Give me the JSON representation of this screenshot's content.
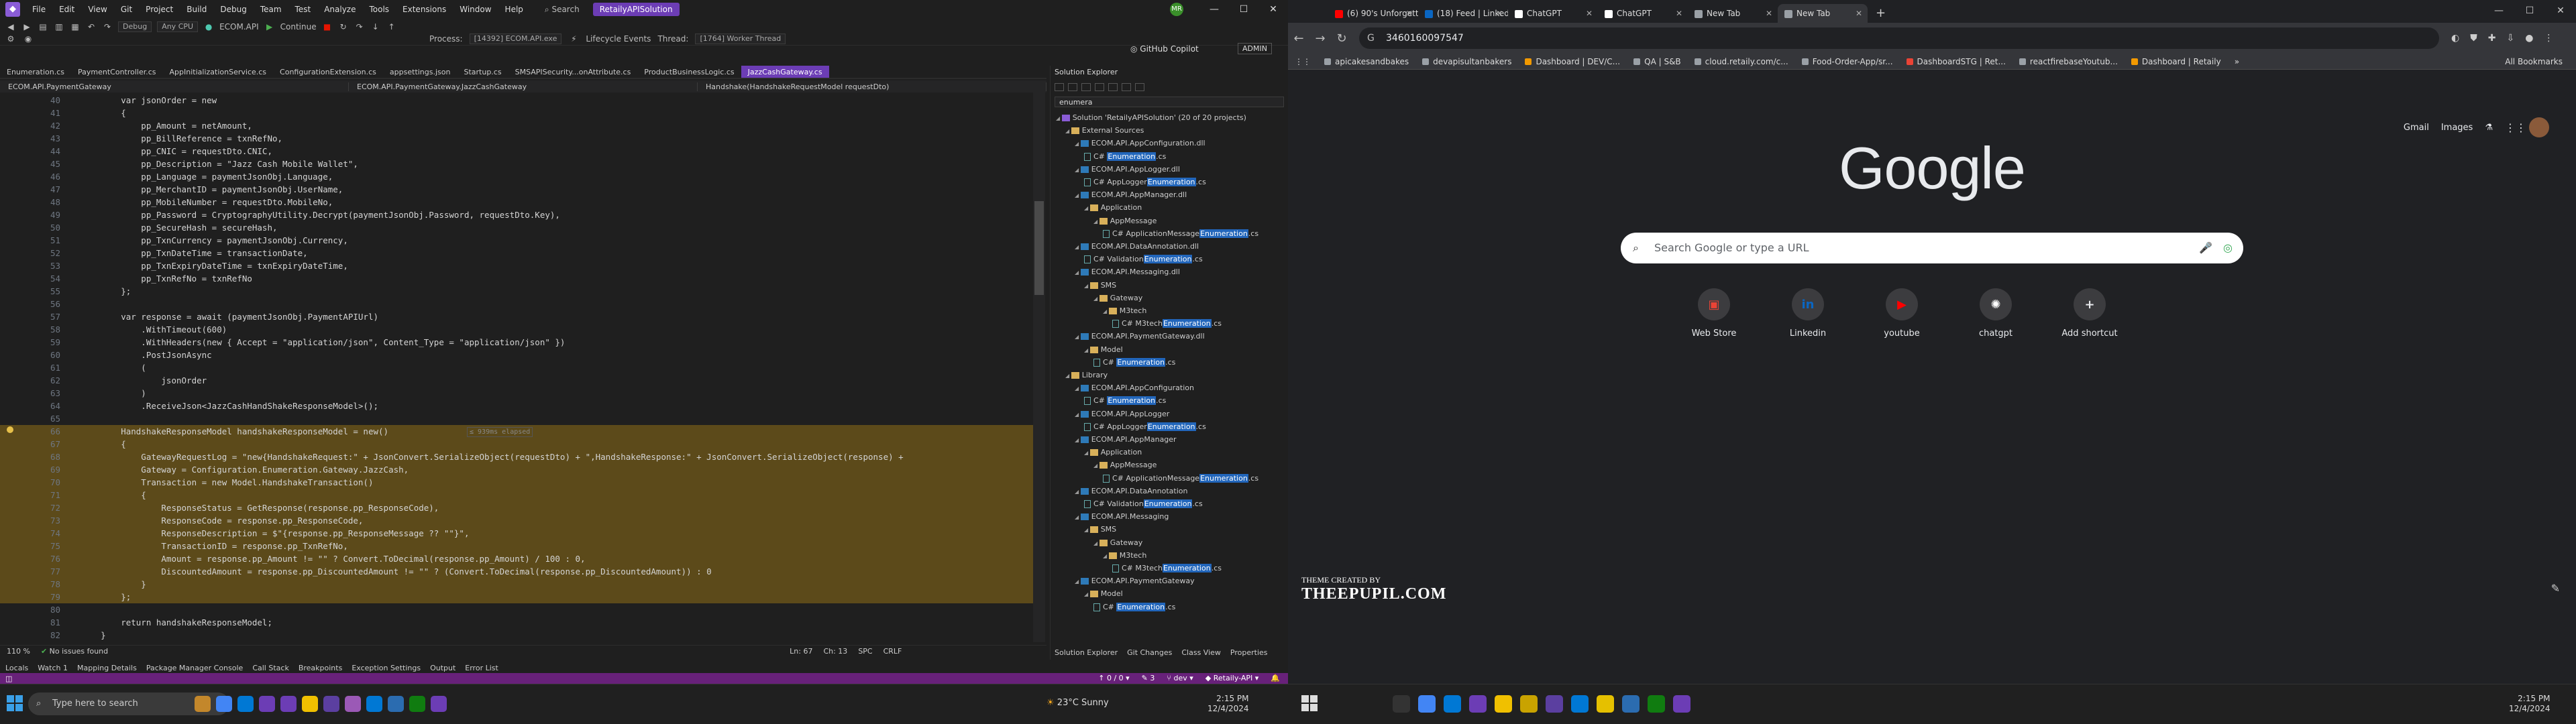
{
  "vs": {
    "menu": [
      "File",
      "Edit",
      "View",
      "Git",
      "Project",
      "Build",
      "Debug",
      "Team",
      "Test",
      "Analyze",
      "Tools",
      "Extensions",
      "Window",
      "Help"
    ],
    "search": "Search",
    "solution_name": "RetailyAPISolution",
    "avatar_initials": "MR",
    "toolbar": {
      "config": "Debug",
      "platform": "Any CPU",
      "startup": "ECOM.API",
      "continue": "Continue",
      "process_label": "Process:",
      "process": "[14392] ECOM.API.exe",
      "lifecycle": "Lifecycle Events",
      "thread_label": "Thread:",
      "thread": "[1764] Worker Thread",
      "copilot": "GitHub Copilot",
      "admin": "ADMIN"
    },
    "tabs": [
      "Enumeration.cs",
      "PaymentController.cs",
      "AppInitializationService.cs",
      "ConfigurationExtension.cs",
      "appsettings.json",
      "Startup.cs",
      "SMSAPISecurity...onAttribute.cs",
      "ProductBusinessLogic.cs",
      "JazzCashGateway.cs"
    ],
    "active_tab": "JazzCashGateway.cs",
    "nav": [
      "ECOM.API.PaymentGateway",
      "ECOM.API.PaymentGateway.JazzCashGateway",
      "Handshake(HandshakeRequestModel requestDto)"
    ],
    "code_lines": [
      {
        "n": "40",
        "t": "        var jsonOrder = new"
      },
      {
        "n": "41",
        "t": "        {"
      },
      {
        "n": "42",
        "t": "            pp_Amount = netAmount,"
      },
      {
        "n": "43",
        "t": "            pp_BillReference = txnRefNo,"
      },
      {
        "n": "44",
        "t": "            pp_CNIC = requestDto.CNIC,"
      },
      {
        "n": "45",
        "t": "            pp_Description = \"Jazz Cash Mobile Wallet\","
      },
      {
        "n": "46",
        "t": "            pp_Language = paymentJsonObj.Language,"
      },
      {
        "n": "47",
        "t": "            pp_MerchantID = paymentJsonObj.UserName,"
      },
      {
        "n": "48",
        "t": "            pp_MobileNumber = requestDto.MobileNo,"
      },
      {
        "n": "49",
        "t": "            pp_Password = CryptographyUtility.Decrypt(paymentJsonObj.Password, requestDto.Key),"
      },
      {
        "n": "50",
        "t": "            pp_SecureHash = secureHash,"
      },
      {
        "n": "51",
        "t": "            pp_TxnCurrency = paymentJsonObj.Currency,"
      },
      {
        "n": "52",
        "t": "            pp_TxnDateTime = transactionDate,"
      },
      {
        "n": "53",
        "t": "            pp_TxnExpiryDateTime = txnExpiryDateTime,"
      },
      {
        "n": "54",
        "t": "            pp_TxnRefNo = txnRefNo"
      },
      {
        "n": "55",
        "t": "        };"
      },
      {
        "n": "56",
        "t": ""
      },
      {
        "n": "57",
        "t": "        var response = await (paymentJsonObj.PaymentAPIUrl)"
      },
      {
        "n": "58",
        "t": "            .WithTimeout(600)"
      },
      {
        "n": "59",
        "t": "            .WithHeaders(new { Accept = \"application/json\", Content_Type = \"application/json\" })"
      },
      {
        "n": "60",
        "t": "            .PostJsonAsync"
      },
      {
        "n": "61",
        "t": "            ("
      },
      {
        "n": "62",
        "t": "                jsonOrder"
      },
      {
        "n": "63",
        "t": "            )"
      },
      {
        "n": "64",
        "t": "            .ReceiveJson<JazzCashHandShakeResponseModel>();"
      },
      {
        "n": "65",
        "t": ""
      },
      {
        "n": "66",
        "t": "        HandshakeResponseModel handshakeResponseModel = new()",
        "hl": true
      },
      {
        "n": "67",
        "t": "        {",
        "hl": true
      },
      {
        "n": "68",
        "t": "            GatewayRequestLog = \"new{HandshakeRequest:\" + JsonConvert.SerializeObject(requestDto) + \",HandshakeResponse:\" + JsonConvert.SerializeObject(response) +",
        "hl": true
      },
      {
        "n": "69",
        "t": "            Gateway = Configuration.Enumeration.Gateway.JazzCash,",
        "hl": true
      },
      {
        "n": "70",
        "t": "            Transaction = new Model.HandshakeTransaction()",
        "hl": true
      },
      {
        "n": "71",
        "t": "            {",
        "hl": true
      },
      {
        "n": "72",
        "t": "                ResponseStatus = GetResponse(response.pp_ResponseCode),",
        "hl": true
      },
      {
        "n": "73",
        "t": "                ResponseCode = response.pp_ResponseCode,",
        "hl": true
      },
      {
        "n": "74",
        "t": "                ResponseDescription = $\"{response.pp_ResponseMessage ?? \"\"}\",",
        "hl": true
      },
      {
        "n": "75",
        "t": "                TransactionID = response.pp_TxnRefNo,",
        "hl": true
      },
      {
        "n": "76",
        "t": "                Amount = response.pp_Amount != \"\" ? Convert.ToDecimal(response.pp_Amount) / 100 : 0,",
        "hl": true
      },
      {
        "n": "77",
        "t": "                DiscountedAmount = response.pp_DiscountedAmount != \"\" ? (Convert.ToDecimal(response.pp_DiscountedAmount)) : 0",
        "hl": true
      },
      {
        "n": "78",
        "t": "            }",
        "hl": true
      },
      {
        "n": "79",
        "t": "        };",
        "hl": true
      },
      {
        "n": "80",
        "t": ""
      },
      {
        "n": "81",
        "t": "        return handshakeResponseModel;"
      },
      {
        "n": "82",
        "t": "    }"
      }
    ],
    "elapsed": "≤ 939ms elapsed",
    "editor_status": {
      "zoom": "110 %",
      "issues": "No issues found",
      "ln": "Ln: 67",
      "ch": "Ch: 13",
      "spc": "SPC",
      "crlf": "CRLF"
    },
    "bottom_tabs": [
      "Locals",
      "Watch 1",
      "Mapping Details",
      "Package Manager Console",
      "Call Stack",
      "Breakpoints",
      "Exception Settings",
      "Output",
      "Error List"
    ],
    "statusbar": {
      "arrows": "↑ 0 / 0 ▾",
      "pencil": "✎ 3",
      "branch": "dev ▾",
      "repo": "Retaily-API ▾"
    },
    "solution_explorer": {
      "title": "Solution Explorer",
      "search": "enumera",
      "tabs": [
        "Solution Explorer",
        "Git Changes",
        "Class View",
        "Properties"
      ],
      "rows": [
        {
          "d": 0,
          "pre": "Solution 'RetailyAPISolution' (20 of 20 projects)",
          "hi": "",
          "post": "",
          "k": "sol"
        },
        {
          "d": 1,
          "pre": "External Sources",
          "hi": "",
          "post": "",
          "k": "folder"
        },
        {
          "d": 2,
          "pre": "ECOM.API.AppConfiguration.dll",
          "hi": "",
          "post": "",
          "k": "file"
        },
        {
          "d": 3,
          "pre": "C# ",
          "hi": "Enumeration",
          "post": ".cs",
          "k": "cs"
        },
        {
          "d": 2,
          "pre": "ECOM.API.AppLogger.dll",
          "hi": "",
          "post": "",
          "k": "file"
        },
        {
          "d": 3,
          "pre": "C# AppLogger",
          "hi": "Enumeration",
          "post": ".cs",
          "k": "cs"
        },
        {
          "d": 2,
          "pre": "ECOM.API.AppManager.dll",
          "hi": "",
          "post": "",
          "k": "file"
        },
        {
          "d": 3,
          "pre": "Application",
          "hi": "",
          "post": "",
          "k": "folder"
        },
        {
          "d": 4,
          "pre": "AppMessage",
          "hi": "",
          "post": "",
          "k": "folder"
        },
        {
          "d": 5,
          "pre": "C# ApplicationMessage",
          "hi": "Enumeration",
          "post": ".cs",
          "k": "cs"
        },
        {
          "d": 2,
          "pre": "ECOM.API.DataAnnotation.dll",
          "hi": "",
          "post": "",
          "k": "file"
        },
        {
          "d": 3,
          "pre": "C# Validation",
          "hi": "Enumeration",
          "post": ".cs",
          "k": "cs"
        },
        {
          "d": 2,
          "pre": "ECOM.API.Messaging.dll",
          "hi": "",
          "post": "",
          "k": "file"
        },
        {
          "d": 3,
          "pre": "SMS",
          "hi": "",
          "post": "",
          "k": "folder"
        },
        {
          "d": 4,
          "pre": "Gateway",
          "hi": "",
          "post": "",
          "k": "folder"
        },
        {
          "d": 5,
          "pre": "M3tech",
          "hi": "",
          "post": "",
          "k": "folder"
        },
        {
          "d": 6,
          "pre": "C# M3tech",
          "hi": "Enumeration",
          "post": ".cs",
          "k": "cs"
        },
        {
          "d": 2,
          "pre": "ECOM.API.PaymentGateway.dll",
          "hi": "",
          "post": "",
          "k": "file"
        },
        {
          "d": 3,
          "pre": "Model",
          "hi": "",
          "post": "",
          "k": "folder"
        },
        {
          "d": 4,
          "pre": "C# ",
          "hi": "Enumeration",
          "post": ".cs",
          "k": "cs"
        },
        {
          "d": 1,
          "pre": "Library",
          "hi": "",
          "post": "",
          "k": "folder"
        },
        {
          "d": 2,
          "pre": "ECOM.API.AppConfiguration",
          "hi": "",
          "post": "",
          "k": "file"
        },
        {
          "d": 3,
          "pre": "C# ",
          "hi": "Enumeration",
          "post": ".cs",
          "k": "cs"
        },
        {
          "d": 2,
          "pre": "ECOM.API.AppLogger",
          "hi": "",
          "post": "",
          "k": "file"
        },
        {
          "d": 3,
          "pre": "C# AppLogger",
          "hi": "Enumeration",
          "post": ".cs",
          "k": "cs"
        },
        {
          "d": 2,
          "pre": "ECOM.API.AppManager",
          "hi": "",
          "post": "",
          "k": "file"
        },
        {
          "d": 3,
          "pre": "Application",
          "hi": "",
          "post": "",
          "k": "folder"
        },
        {
          "d": 4,
          "pre": "AppMessage",
          "hi": "",
          "post": "",
          "k": "folder"
        },
        {
          "d": 5,
          "pre": "C# ApplicationMessage",
          "hi": "Enumeration",
          "post": ".cs",
          "k": "cs"
        },
        {
          "d": 2,
          "pre": "ECOM.API.DataAnnotation",
          "hi": "",
          "post": "",
          "k": "file"
        },
        {
          "d": 3,
          "pre": "C# Validation",
          "hi": "Enumeration",
          "post": ".cs",
          "k": "cs"
        },
        {
          "d": 2,
          "pre": "ECOM.API.Messaging",
          "hi": "",
          "post": "",
          "k": "file"
        },
        {
          "d": 3,
          "pre": "SMS",
          "hi": "",
          "post": "",
          "k": "folder"
        },
        {
          "d": 4,
          "pre": "Gateway",
          "hi": "",
          "post": "",
          "k": "folder"
        },
        {
          "d": 5,
          "pre": "M3tech",
          "hi": "",
          "post": "",
          "k": "folder"
        },
        {
          "d": 6,
          "pre": "C# M3tech",
          "hi": "Enumeration",
          "post": ".cs",
          "k": "cs"
        },
        {
          "d": 2,
          "pre": "ECOM.API.PaymentGateway",
          "hi": "",
          "post": "",
          "k": "file"
        },
        {
          "d": 3,
          "pre": "Model",
          "hi": "",
          "post": "",
          "k": "folder"
        },
        {
          "d": 4,
          "pre": "C# ",
          "hi": "Enumeration",
          "post": ".cs",
          "k": "cs"
        }
      ]
    }
  },
  "chrome": {
    "tabs": [
      {
        "label": "(6) 90's Unforgettable Go...",
        "color": "#ff0000"
      },
      {
        "label": "(18) Feed | LinkedIn",
        "color": "#0a66c2"
      },
      {
        "label": "ChatGPT",
        "color": "#ffffff"
      },
      {
        "label": "ChatGPT",
        "color": "#ffffff"
      },
      {
        "label": "New Tab",
        "color": "#9aa0a6"
      },
      {
        "label": "New Tab",
        "color": "#9aa0a6",
        "active": true
      }
    ],
    "url": "3460160097547",
    "bookmarks": [
      {
        "label": "apicakesandbakes",
        "color": "#9aa0a6"
      },
      {
        "label": "devapisultanbakers",
        "color": "#9aa0a6"
      },
      {
        "label": "Dashboard | DEV/C...",
        "color": "#f29900"
      },
      {
        "label": "QA | S&B",
        "color": "#9aa0a6"
      },
      {
        "label": "cloud.retaily.com/c...",
        "color": "#9aa0a6"
      },
      {
        "label": "Food-Order-App/sr...",
        "color": "#9aa0a6"
      },
      {
        "label": "DashboardSTG | Ret...",
        "color": "#ea4335"
      },
      {
        "label": "reactfirebaseYoutub...",
        "color": "#9aa0a6"
      },
      {
        "label": "Dashboard | Retaily",
        "color": "#f29900"
      }
    ],
    "all_bookmarks": "All Bookmarks",
    "top_links": {
      "gmail": "Gmail",
      "images": "Images"
    },
    "logo": "Google",
    "search_placeholder": "Search Google or type a URL",
    "shortcuts": [
      {
        "label": "Web Store",
        "glyph": "▣",
        "color": "#ea4335"
      },
      {
        "label": "Linkedin",
        "glyph": "in",
        "color": "#0a66c2"
      },
      {
        "label": "youtube",
        "glyph": "▶",
        "color": "#ff0000"
      },
      {
        "label": "chatgpt",
        "glyph": "✺",
        "color": "#ffffff"
      },
      {
        "label": "Add shortcut",
        "glyph": "+",
        "color": "#e8eaed"
      }
    ],
    "credit_small": "THEME CREATED BY",
    "credit_big": "THEEPUPIL.COM"
  },
  "taskbar": {
    "search_placeholder": "Type here to search",
    "weather": "23°C  Sunny",
    "tray_left": {
      "time": "2:15 PM",
      "date": "12/4/2024"
    },
    "tray_right": {
      "time": "2:15 PM",
      "date": "12/4/2024"
    }
  }
}
